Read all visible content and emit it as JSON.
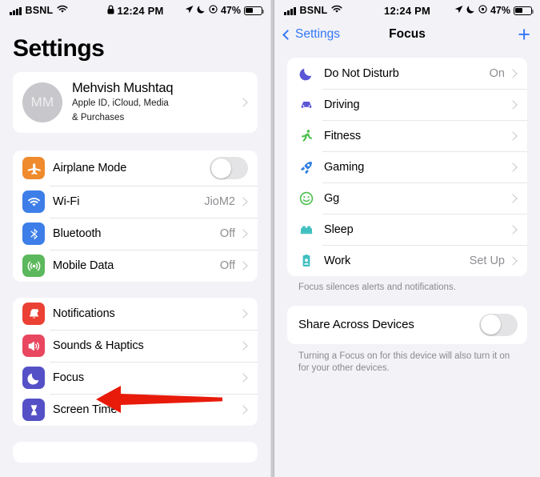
{
  "status_bar": {
    "carrier": "BSNL",
    "wifi_icon": "wifi-icon",
    "lock_icon": "lock-icon",
    "time": "12:24 PM",
    "location_icon": "location-arrow-icon",
    "moon_icon": "moon-icon",
    "orientation_lock_icon": "orientation-lock-icon",
    "battery_percent": "47%"
  },
  "left_panel": {
    "title": "Settings",
    "profile": {
      "initials": "MM",
      "name": "Mehvish Mushtaq",
      "subtitle_line1": "Apple ID, iCloud, Media",
      "subtitle_line2": "& Purchases"
    },
    "group_connectivity": [
      {
        "icon": "airplane-icon",
        "label": "Airplane Mode",
        "value": "",
        "control": "toggle",
        "toggle_on": false,
        "color": "#ef8b2c"
      },
      {
        "icon": "wifi-icon",
        "label": "Wi-Fi",
        "value": "JioM2",
        "control": "chevron",
        "color": "#3d7ee8"
      },
      {
        "icon": "bluetooth-icon",
        "label": "Bluetooth",
        "value": "Off",
        "control": "chevron",
        "color": "#3d7ee8"
      },
      {
        "icon": "mobile-data-icon",
        "label": "Mobile Data",
        "value": "Off",
        "control": "chevron",
        "color": "#5cb85c"
      }
    ],
    "group_system": [
      {
        "icon": "bell-icon",
        "label": "Notifications",
        "value": "",
        "control": "chevron",
        "color": "#eb4034"
      },
      {
        "icon": "speaker-icon",
        "label": "Sounds & Haptics",
        "value": "",
        "control": "chevron",
        "color": "#e8475f"
      },
      {
        "icon": "moon-icon",
        "label": "Focus",
        "value": "",
        "control": "chevron",
        "color": "#5451c6"
      },
      {
        "icon": "hourglass-icon",
        "label": "Screen Time",
        "value": "",
        "control": "chevron",
        "color": "#5451c6"
      }
    ],
    "annotation": {
      "type": "red-arrow",
      "points_at": "Focus",
      "color": "#e81b0b"
    }
  },
  "right_panel": {
    "back_label": "Settings",
    "title": "Focus",
    "add_label": "+",
    "focus_modes": [
      {
        "icon": "moon-icon",
        "label": "Do Not Disturb",
        "value": "On",
        "color": "#5b56d6"
      },
      {
        "icon": "car-icon",
        "label": "Driving",
        "value": "",
        "color": "#5b56d6"
      },
      {
        "icon": "runner-icon",
        "label": "Fitness",
        "value": "",
        "color": "#4cc04c"
      },
      {
        "icon": "rocket-icon",
        "label": "Gaming",
        "value": "",
        "color": "#2f7de1"
      },
      {
        "icon": "smiley-icon",
        "label": "Gg",
        "value": "",
        "color": "#4cc04c"
      },
      {
        "icon": "bed-icon",
        "label": "Sleep",
        "value": "",
        "color": "#41bfc0"
      },
      {
        "icon": "id-badge-icon",
        "label": "Work",
        "value": "Set Up",
        "color": "#41bfc0"
      }
    ],
    "focus_footnote": "Focus silences alerts and notifications.",
    "share": {
      "label": "Share Across Devices",
      "toggle_on": false,
      "footnote": "Turning a Focus on for this device will also turn it on for your other devices."
    }
  }
}
